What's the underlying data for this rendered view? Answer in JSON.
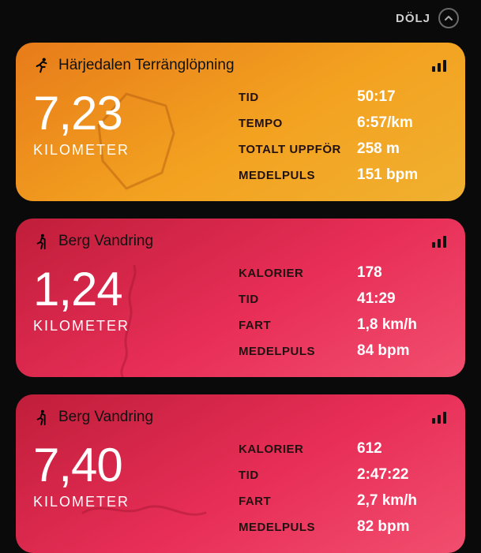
{
  "topbar": {
    "hide_label": "DÖLJ"
  },
  "unit_label": "KILOMETER",
  "cards": [
    {
      "title": "Härjedalen Terränglöpning",
      "distance": "7,23",
      "metrics": [
        {
          "label": "TID",
          "value": "50:17"
        },
        {
          "label": "TEMPO",
          "value": "6:57/km"
        },
        {
          "label": "TOTALT UPPFÖR",
          "value": "258 m"
        },
        {
          "label": "MEDELPULS",
          "value": "151 bpm"
        }
      ]
    },
    {
      "title": "Berg Vandring",
      "distance": "1,24",
      "metrics": [
        {
          "label": "KALORIER",
          "value": "178"
        },
        {
          "label": "TID",
          "value": "41:29"
        },
        {
          "label": "FART",
          "value": "1,8 km/h"
        },
        {
          "label": "MEDELPULS",
          "value": "84 bpm"
        }
      ]
    },
    {
      "title": "Berg Vandring",
      "distance": "7,40",
      "metrics": [
        {
          "label": "KALORIER",
          "value": "612"
        },
        {
          "label": "TID",
          "value": "2:47:22"
        },
        {
          "label": "FART",
          "value": "2,7 km/h"
        },
        {
          "label": "MEDELPULS",
          "value": "82 bpm"
        }
      ]
    }
  ]
}
